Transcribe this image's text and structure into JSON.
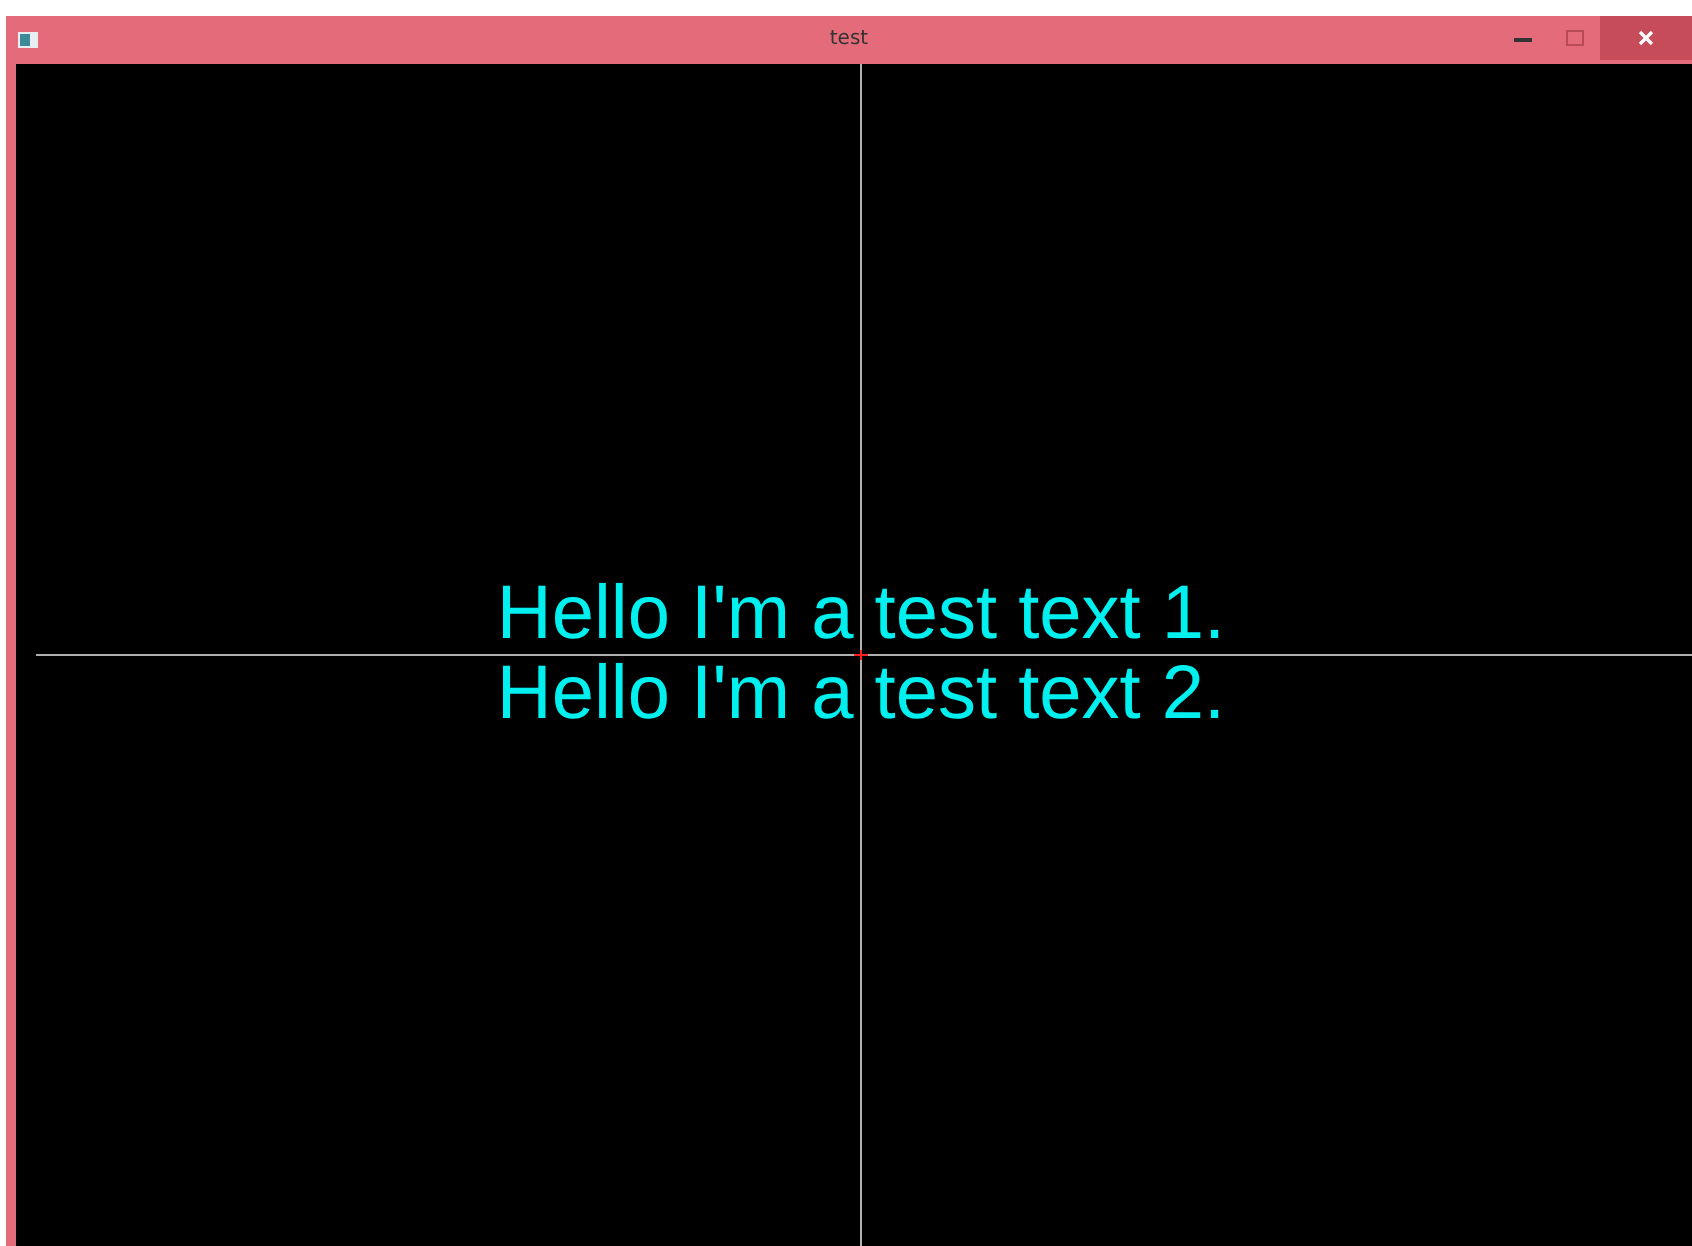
{
  "window": {
    "title": "test"
  },
  "canvas": {
    "lines": [
      "Hello I'm a test text 1.",
      "Hello I'm a test text 2."
    ]
  }
}
